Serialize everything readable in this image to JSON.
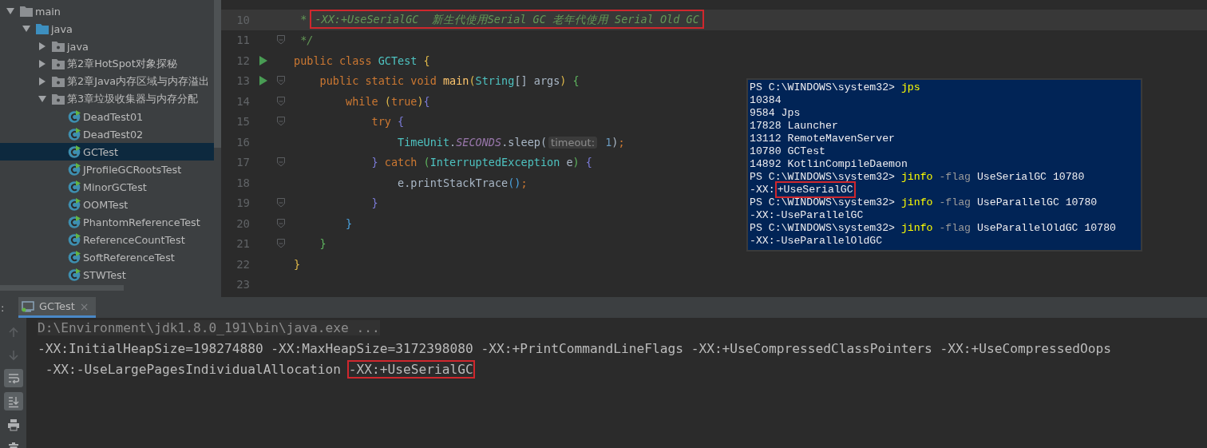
{
  "sidebar": {
    "items": [
      {
        "label": "main",
        "kind": "folder",
        "expanded": true,
        "selected": false,
        "children": [
          {
            "label": "java",
            "kind": "source",
            "expanded": true,
            "selected": false,
            "children": [
              {
                "label": "java",
                "kind": "package",
                "expanded": false,
                "selected": false
              },
              {
                "label": "第2章HotSpot对象探秘",
                "kind": "package",
                "expanded": false,
                "selected": false
              },
              {
                "label": "第2章Java内存区域与内存溢出",
                "kind": "package",
                "expanded": false,
                "selected": false
              },
              {
                "label": "第3章垃圾收集器与内存分配",
                "kind": "package",
                "expanded": true,
                "selected": false,
                "children": [
                  {
                    "label": "DeadTest01",
                    "kind": "class",
                    "selected": false
                  },
                  {
                    "label": "DeadTest02",
                    "kind": "class",
                    "selected": false
                  },
                  {
                    "label": "GCTest",
                    "kind": "class",
                    "selected": true
                  },
                  {
                    "label": "JProfileGCRootsTest",
                    "kind": "class",
                    "selected": false
                  },
                  {
                    "label": "MinorGCTest",
                    "kind": "class",
                    "selected": false
                  },
                  {
                    "label": "OOMTest",
                    "kind": "class",
                    "selected": false
                  },
                  {
                    "label": "PhantomReferenceTest",
                    "kind": "class",
                    "selected": false
                  },
                  {
                    "label": "ReferenceCountTest",
                    "kind": "class",
                    "selected": false
                  },
                  {
                    "label": "SoftReferenceTest",
                    "kind": "class",
                    "selected": false
                  },
                  {
                    "label": "STWTest",
                    "kind": "class",
                    "selected": false
                  }
                ]
              }
            ]
          }
        ]
      }
    ]
  },
  "editor": {
    "lines": [
      {
        "number": "10",
        "current": true,
        "run": false,
        "fold": false,
        "tokens": [
          {
            "text": " * ",
            "kind": "comment"
          },
          {
            "text": "-XX:+UseSerialGC  新生代使用Serial GC 老年代使用 Serial Old GC",
            "kind": "comment",
            "boxed": true
          }
        ]
      },
      {
        "number": "11",
        "current": false,
        "run": false,
        "fold": true,
        "tokens": [
          {
            "text": " */",
            "kind": "comment"
          }
        ]
      },
      {
        "number": "12",
        "current": false,
        "run": true,
        "fold": false,
        "tokens": [
          {
            "text": "public class ",
            "kind": "keyword"
          },
          {
            "text": "GCTest ",
            "kind": "class"
          },
          {
            "text": "{",
            "kind": "brace1"
          }
        ]
      },
      {
        "number": "13",
        "current": false,
        "run": true,
        "fold": true,
        "tokens": [
          {
            "text": "    public static void ",
            "kind": "keyword"
          },
          {
            "text": "main",
            "kind": "method"
          },
          {
            "text": "(",
            "kind": "brace1"
          },
          {
            "text": "String",
            "kind": "class"
          },
          {
            "text": "[] args",
            "kind": "plain"
          },
          {
            "text": ")",
            "kind": "brace1"
          },
          {
            "text": " {",
            "kind": "brace2"
          }
        ]
      },
      {
        "number": "14",
        "current": false,
        "run": false,
        "fold": true,
        "tokens": [
          {
            "text": "        while ",
            "kind": "keyword"
          },
          {
            "text": "(",
            "kind": "brace1"
          },
          {
            "text": "true",
            "kind": "keyword"
          },
          {
            "text": ")",
            "kind": "brace1"
          },
          {
            "text": "{",
            "kind": "brace3"
          }
        ]
      },
      {
        "number": "15",
        "current": false,
        "run": false,
        "fold": true,
        "tokens": [
          {
            "text": "            try ",
            "kind": "keyword"
          },
          {
            "text": "{",
            "kind": "brace3"
          }
        ]
      },
      {
        "number": "16",
        "current": false,
        "run": false,
        "fold": false,
        "tokens": [
          {
            "text": "                TimeUnit",
            "kind": "class"
          },
          {
            "text": ".",
            "kind": "plain"
          },
          {
            "text": "SECONDS",
            "kind": "static"
          },
          {
            "text": ".sleep(",
            "kind": "plain"
          },
          {
            "text": "timeout:",
            "kind": "hint"
          },
          {
            "text": " 1",
            "kind": "number"
          },
          {
            "text": ")",
            "kind": "plain"
          },
          {
            "text": ";",
            "kind": "keyword"
          }
        ]
      },
      {
        "number": "17",
        "current": false,
        "run": false,
        "fold": true,
        "tokens": [
          {
            "text": "            } ",
            "kind": "brace3"
          },
          {
            "text": "catch ",
            "kind": "keyword"
          },
          {
            "text": "(",
            "kind": "brace2"
          },
          {
            "text": "InterruptedException",
            "kind": "class"
          },
          {
            "text": " e",
            "kind": "plain"
          },
          {
            "text": ")",
            "kind": "brace2"
          },
          {
            "text": " {",
            "kind": "brace3"
          }
        ]
      },
      {
        "number": "18",
        "current": false,
        "run": false,
        "fold": false,
        "tokens": [
          {
            "text": "                e.printStackTrace",
            "kind": "plain"
          },
          {
            "text": "()",
            "kind": "brace4"
          },
          {
            "text": ";",
            "kind": "keyword"
          }
        ]
      },
      {
        "number": "19",
        "current": false,
        "run": false,
        "fold": true,
        "tokens": [
          {
            "text": "            }",
            "kind": "brace3"
          }
        ]
      },
      {
        "number": "20",
        "current": false,
        "run": false,
        "fold": true,
        "tokens": [
          {
            "text": "        }",
            "kind": "brace4"
          }
        ]
      },
      {
        "number": "21",
        "current": false,
        "run": false,
        "fold": true,
        "tokens": [
          {
            "text": "    }",
            "kind": "brace2"
          }
        ]
      },
      {
        "number": "22",
        "current": false,
        "run": false,
        "fold": false,
        "tokens": [
          {
            "text": "}",
            "kind": "brace1"
          }
        ]
      },
      {
        "number": "23",
        "current": false,
        "run": false,
        "fold": false
      }
    ]
  },
  "terminal": {
    "lines": [
      [
        {
          "text": "PS C:\\WINDOWS\\system32> ",
          "kind": "plain"
        },
        {
          "text": "jps",
          "kind": "command"
        }
      ],
      [
        {
          "text": "10384",
          "kind": "plain"
        }
      ],
      [
        {
          "text": "9584 Jps",
          "kind": "plain"
        }
      ],
      [
        {
          "text": "17828 Launcher",
          "kind": "plain"
        }
      ],
      [
        {
          "text": "13112 RemoteMavenServer",
          "kind": "plain"
        }
      ],
      [
        {
          "text": "10780 GCTest",
          "kind": "plain"
        }
      ],
      [
        {
          "text": "14892 KotlinCompileDaemon",
          "kind": "plain"
        }
      ],
      [
        {
          "text": "PS C:\\WINDOWS\\system32> ",
          "kind": "plain"
        },
        {
          "text": "jinfo",
          "kind": "command"
        },
        {
          "text": " -flag",
          "kind": "param"
        },
        {
          "text": " UseSerialGC 10780",
          "kind": "plain"
        }
      ],
      [
        {
          "text": "-XX:",
          "kind": "plain"
        },
        {
          "text": "+UseSerialGC",
          "kind": "plain",
          "boxed": true
        }
      ],
      [
        {
          "text": "PS C:\\WINDOWS\\system32> ",
          "kind": "plain"
        },
        {
          "text": "jinfo",
          "kind": "command"
        },
        {
          "text": " -flag",
          "kind": "param"
        },
        {
          "text": " UseParallelGC 10780",
          "kind": "plain"
        }
      ],
      [
        {
          "text": "-XX:-UseParallelGC",
          "kind": "plain"
        }
      ],
      [
        {
          "text": "PS C:\\WINDOWS\\system32> ",
          "kind": "plain"
        },
        {
          "text": "jinfo",
          "kind": "command"
        },
        {
          "text": " -flag",
          "kind": "param"
        },
        {
          "text": " UseParallelOldGC 10780",
          "kind": "plain"
        }
      ],
      [
        {
          "text": "-XX:-UseParallelOldGC",
          "kind": "plain"
        }
      ]
    ]
  },
  "run_panel": {
    "label": ":",
    "tabs": [
      {
        "label": "GCTest",
        "close": "×",
        "selected": true
      }
    ],
    "toolbar": [
      {
        "kind": "up",
        "on": false
      },
      {
        "kind": "down",
        "on": false
      },
      {
        "kind": "wrap",
        "on": true
      },
      {
        "kind": "scroll-end",
        "on": true
      },
      {
        "kind": "print",
        "on": false
      },
      {
        "kind": "trash",
        "on": false
      }
    ],
    "console": [
      [
        {
          "text": "D:\\Environment\\jdk1.8.0_191\\bin\\java.exe ...",
          "kind": "command-line"
        }
      ],
      [
        {
          "text": "-XX:InitialHeapSize=198274880 -XX:MaxHeapSize=3172398080 -XX:+PrintCommandLineFlags -XX:+UseCompressedClassPointers -XX:+UseCompressedOops",
          "kind": "output"
        }
      ],
      [
        {
          "text": " -XX:-UseLargePagesIndividualAllocation ",
          "kind": "output"
        },
        {
          "text": "-XX:+UseSerialGC",
          "kind": "output",
          "boxed": true
        }
      ]
    ]
  }
}
